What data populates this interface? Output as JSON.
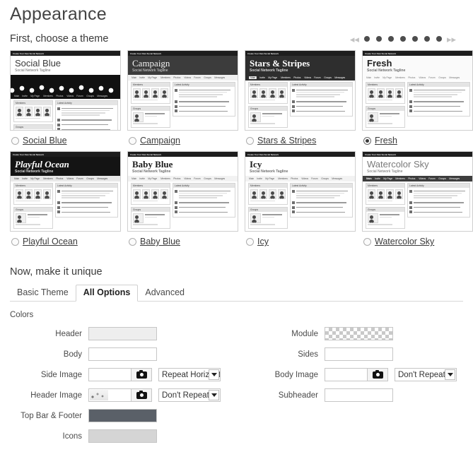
{
  "page": {
    "title": "Appearance"
  },
  "theme_section": {
    "heading": "First, choose a theme",
    "pager": {
      "prev_icon": "double-chevron-left",
      "next_icon": "double-chevron-right",
      "dot_count": 7
    },
    "tagline": "Social Network Tagline",
    "topbar_text": "Create Your Own Social Network",
    "nav_items": [
      "Main",
      "Invite",
      "My Page",
      "Members",
      "Photos",
      "Videos",
      "Forum",
      "Groups",
      "Messages"
    ],
    "panel_members": "Members",
    "panel_groups": "Groups",
    "panel_activity": "Latest Activity",
    "themes": [
      {
        "name": "Social Blue",
        "selected": false
      },
      {
        "name": "Campaign",
        "selected": false
      },
      {
        "name": "Stars & Stripes",
        "selected": false
      },
      {
        "name": "Fresh",
        "selected": true
      },
      {
        "name": "Playful Ocean",
        "selected": false
      },
      {
        "name": "Baby Blue",
        "selected": false
      },
      {
        "name": "Icy",
        "selected": false
      },
      {
        "name": "Watercolor Sky",
        "selected": false
      }
    ]
  },
  "unique_section": {
    "heading": "Now, make it unique",
    "tabs": [
      {
        "label": "Basic Theme",
        "active": false
      },
      {
        "label": "All Options",
        "active": true
      },
      {
        "label": "Advanced",
        "active": false
      }
    ],
    "colors_heading": "Colors",
    "left_fields": [
      {
        "label": "Header",
        "type": "color",
        "value": "#eeeeee"
      },
      {
        "label": "Body",
        "type": "color",
        "value": "#ffffff"
      },
      {
        "label": "Side Image",
        "type": "image",
        "select_value": "Repeat Horizontally",
        "has_thumb": false
      },
      {
        "label": "Header Image",
        "type": "image",
        "select_value": "Don't Repeat",
        "has_thumb": true
      },
      {
        "label": "Top Bar & Footer",
        "type": "color",
        "value": "#5a6068"
      },
      {
        "label": "Icons",
        "type": "color",
        "value": "#d5d5d5"
      }
    ],
    "right_fields": [
      {
        "label": "Module",
        "type": "color",
        "value": "transparent"
      },
      {
        "label": "Sides",
        "type": "color",
        "value": "#ffffff"
      },
      {
        "label": "Body Image",
        "type": "image",
        "select_value": "Don't Repeat",
        "has_thumb": false
      },
      {
        "label": "Subheader",
        "type": "color",
        "value": "#ffffff"
      }
    ],
    "camera_icon": "camera-icon",
    "dropdown_icon": "chevron-down-icon"
  }
}
